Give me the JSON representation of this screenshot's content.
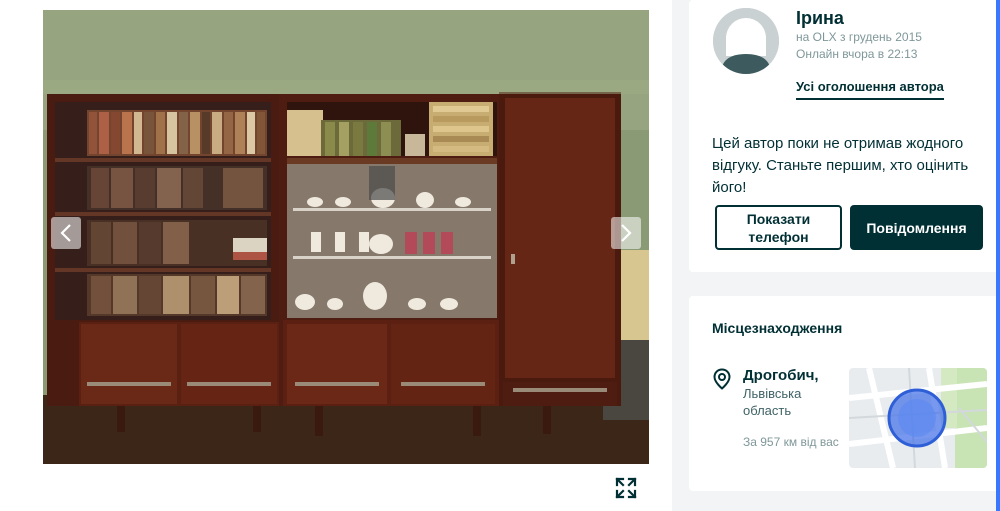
{
  "seller": {
    "name": "Ірина",
    "since": "на OLX з грудень 2015",
    "online": "Онлайн вчора в 22:13",
    "all_ads_link": "Усі оголошення автора",
    "review_text": "Цей автор поки не отримав жодного відгуку. Станьте першим, хто оцінить його!",
    "show_phone_button": "Показати телефон",
    "message_button": "Повідомлення"
  },
  "location": {
    "title": "Місцезнаходження",
    "city": "Дрогобич,",
    "region": "Львівська область",
    "distance": "За 957 км від вас"
  },
  "gallery": {
    "photo_subject": "wooden bookcase with glass display cabinet",
    "prev_icon": "chevron-left-icon",
    "next_icon": "chevron-right-icon",
    "fullscreen_icon": "expand-icon"
  },
  "colors": {
    "primary": "#002f34",
    "muted": "#7f9799",
    "page_background": "#f2f4f5",
    "accent_blue": "#3a77ff"
  }
}
